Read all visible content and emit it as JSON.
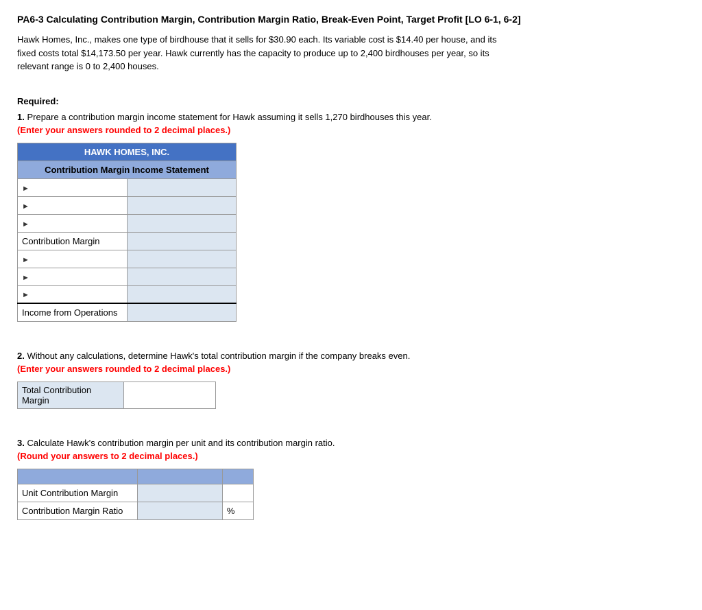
{
  "title": "PA6-3 Calculating Contribution Margin, Contribution Margin Ratio, Break-Even Point, Target Profit [LO 6-1, 6-2]",
  "intro": "Hawk Homes, Inc., makes one type of birdhouse that it sells for $30.90 each. Its variable cost is $14.40 per house, and its fixed costs total $14,173.50 per year. Hawk currently has the capacity to produce up to 2,400 birdhouses per year, so its relevant range is 0 to 2,400 houses.",
  "required_label": "Required:",
  "questions": {
    "q1": {
      "number": "1.",
      "text": "Prepare a contribution margin income statement for Hawk assuming it sells 1,270 birdhouses this year.",
      "note": "(Enter your answers rounded to 2 decimal places.)",
      "company_name": "HAWK HOMES, INC.",
      "statement_title": "Contribution Margin Income Statement",
      "rows": [
        {
          "label": "",
          "has_input": true
        },
        {
          "label": "",
          "has_input": true
        },
        {
          "label": "",
          "has_input": true
        },
        {
          "label": "Contribution Margin",
          "has_input": true
        },
        {
          "label": "",
          "has_input": true
        },
        {
          "label": "",
          "has_input": true
        },
        {
          "label": "",
          "has_input": true
        },
        {
          "label": "Income from Operations",
          "has_input": true
        }
      ]
    },
    "q2": {
      "number": "2.",
      "text": "Without any calculations, determine Hawk's total contribution margin if the company breaks even.",
      "note": "(Enter your answers rounded to 2 decimal places.)",
      "label": "Total Contribution Margin"
    },
    "q3": {
      "number": "3.",
      "text": "Calculate Hawk's contribution margin per unit and its contribution margin ratio.",
      "note": "(Round your answers to 2 decimal places.)",
      "rows": [
        {
          "label": "Unit Contribution Margin",
          "suffix": ""
        },
        {
          "label": "Contribution Margin Ratio",
          "suffix": "%"
        }
      ]
    }
  }
}
